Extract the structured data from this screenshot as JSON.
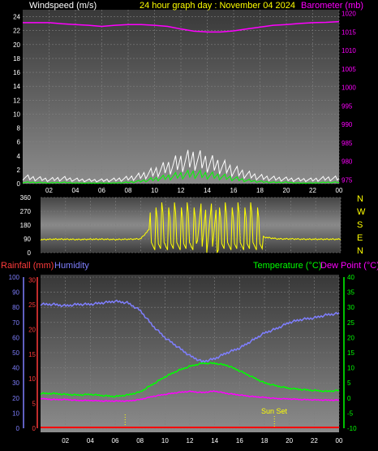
{
  "top": {
    "left_label": "Windspeed (m/s)",
    "center_label": "24 hour graph day : November 04 2024",
    "right_label": "Barometer (mb)",
    "colors": {
      "left_label": "#ffffff",
      "center_label": "#ffff00",
      "right_label": "#ff00ff"
    }
  },
  "bottom": {
    "rain_label": "Rainfall (mm)",
    "humidity_label": "Humidity",
    "temp_label": "Temperature (°C)",
    "dew_label": "Dew Point (°C)",
    "sunset_label": "Sun Set",
    "colors": {
      "rain": "#ff3b3b",
      "humidity": "#7f7fff",
      "temp": "#00ff00",
      "dew": "#ff00ff"
    }
  },
  "x_ticks": [
    "02",
    "04",
    "06",
    "08",
    "10",
    "12",
    "14",
    "16",
    "18",
    "20",
    "22",
    "00"
  ],
  "wind_ticks": [
    "24",
    "22",
    "20",
    "18",
    "16",
    "14",
    "12",
    "10",
    "8",
    "6",
    "4",
    "2",
    "0"
  ],
  "baro_ticks": [
    "1020",
    "1015",
    "1010",
    "1005",
    "1000",
    "995",
    "990",
    "985",
    "980",
    "975"
  ],
  "dir_ticks": [
    "360",
    "270",
    "180",
    "90",
    "0"
  ],
  "dir_letters": [
    "N",
    "W",
    "S",
    "E",
    "N"
  ],
  "hum_ticks": [
    "100",
    "90",
    "80",
    "70",
    "60",
    "50",
    "40",
    "30",
    "20",
    "10",
    "0"
  ],
  "rain_ticks": [
    "30",
    "25",
    "20",
    "15",
    "10",
    "5",
    "0"
  ],
  "temp_ticks": [
    "40",
    "35",
    "30",
    "25",
    "20",
    "15",
    "10",
    "5",
    "0",
    "-5",
    "-10"
  ],
  "chart_data": [
    {
      "type": "line",
      "title": "24 hour graph day : November 04 2024",
      "xlabel": "",
      "ylabel": "Windspeed (m/s)",
      "y2label": "Barometer (mb)",
      "ylim": [
        0,
        25
      ],
      "y2lim": [
        974,
        1021
      ],
      "x": [
        0,
        1,
        2,
        3,
        4,
        5,
        6,
        7,
        8,
        9,
        10,
        11,
        12,
        13,
        14,
        15,
        16,
        17,
        18,
        19,
        20,
        21,
        22,
        23,
        24
      ],
      "series": [
        {
          "name": "Barometer (mb)",
          "axis": "y2",
          "color": "#ff00ff",
          "values": [
            1017.5,
            1017.5,
            1017.5,
            1017.2,
            1017,
            1016.8,
            1016.5,
            1016.8,
            1017,
            1017,
            1016.8,
            1016.5,
            1015.8,
            1015.2,
            1015,
            1015,
            1015.3,
            1015.8,
            1016.3,
            1016.8,
            1017,
            1017.3,
            1017.5,
            1017.6,
            1017.8
          ]
        },
        {
          "name": "Windspeed gust",
          "axis": "y",
          "color": "#ffffff",
          "values": [
            1,
            0.8,
            0.6,
            0.8,
            0.6,
            0.5,
            0.5,
            0.6,
            0.8,
            1.2,
            1.8,
            2.5,
            3.3,
            3.8,
            3.2,
            2.7,
            2,
            1.4,
            1,
            0.8,
            0.7,
            0.6,
            0.6,
            0.8,
            0.8
          ]
        },
        {
          "name": "Windspeed average",
          "axis": "y",
          "color": "#00ff00",
          "values": [
            0.2,
            0.2,
            0.1,
            0.2,
            0.1,
            0.1,
            0.1,
            0.1,
            0.2,
            0.4,
            0.7,
            1,
            1.3,
            1.5,
            1.3,
            1.1,
            0.8,
            0.5,
            0.3,
            0.2,
            0.2,
            0.1,
            0.1,
            0.2,
            0.2
          ]
        }
      ]
    },
    {
      "type": "line",
      "title": "",
      "xlabel": "",
      "ylabel": "",
      "ylim": [
        0,
        360
      ],
      "x": [
        0,
        1,
        2,
        3,
        4,
        5,
        6,
        7,
        8,
        9,
        10,
        11,
        12,
        13,
        14,
        15,
        16,
        17,
        18,
        19,
        20,
        21,
        22,
        23,
        24
      ],
      "series": [
        {
          "name": "Wind direction",
          "color": "#ffff00",
          "values": [
            85,
            88,
            88,
            86,
            88,
            88,
            86,
            88,
            90,
            180,
            270,
            200,
            300,
            220,
            150,
            110,
            100,
            120,
            100,
            90,
            90,
            88,
            88,
            88,
            88
          ]
        }
      ]
    },
    {
      "type": "line",
      "title": "",
      "xlabel": "",
      "ylabel": "Rainfall (mm)",
      "ylim": [
        -10,
        40
      ],
      "x": [
        0,
        1,
        2,
        3,
        4,
        5,
        6,
        7,
        8,
        9,
        10,
        11,
        12,
        13,
        14,
        15,
        16,
        17,
        18,
        19,
        20,
        21,
        22,
        23,
        24
      ],
      "series": [
        {
          "name": "Humidity",
          "axis": "humidity",
          "color": "#7f7fff",
          "values": [
            82,
            82,
            81,
            82,
            82,
            83,
            84,
            83,
            78,
            68,
            60,
            54,
            48,
            44,
            46,
            50,
            53,
            58,
            63,
            66,
            70,
            72,
            73,
            75,
            76
          ]
        },
        {
          "name": "Temperature (°C)",
          "color": "#00ff00",
          "values": [
            1.5,
            1.5,
            1.2,
            1,
            1.2,
            0.8,
            0.5,
            1,
            2,
            4.5,
            7,
            9,
            10.5,
            11.5,
            11.5,
            10.8,
            9,
            7,
            5,
            4,
            3.2,
            2.8,
            2.5,
            2.2,
            2.5
          ]
        },
        {
          "name": "Dew Point (°C)",
          "color": "#ff00ff",
          "values": [
            -0.2,
            -0.5,
            -0.5,
            -0.8,
            -0.8,
            -1,
            -1,
            -1,
            -0.5,
            0.5,
            1.2,
            1.8,
            2.2,
            1.8,
            2.3,
            1.5,
            1,
            0.5,
            0.2,
            -0.2,
            -0.3,
            -0.5,
            -0.6,
            -0.7,
            -0.7
          ]
        },
        {
          "name": "Rainfall (mm)",
          "axis": "rain",
          "color": "#ff0000",
          "values": [
            0,
            0,
            0,
            0,
            0,
            0,
            0,
            0,
            0,
            0,
            0,
            0,
            0,
            0,
            0,
            0,
            0,
            0,
            0,
            0,
            0,
            0,
            0,
            0,
            0
          ]
        }
      ]
    }
  ]
}
